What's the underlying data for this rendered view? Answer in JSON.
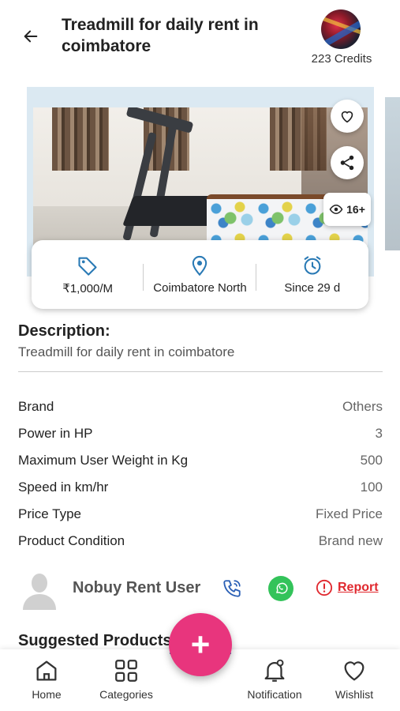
{
  "header": {
    "title": "Treadmill for daily rent in coimbatore",
    "credits": "223 Credits"
  },
  "listing": {
    "views_badge": "16+",
    "price": "₹1,000/M",
    "location": "Coimbatore North",
    "since": "Since 29 d"
  },
  "description": {
    "heading": "Description:",
    "text": "Treadmill for daily rent in coimbatore"
  },
  "specs": [
    {
      "label": "Brand",
      "value": "Others"
    },
    {
      "label": "Power in HP",
      "value": "3"
    },
    {
      "label": "Maximum User Weight in Kg",
      "value": "500"
    },
    {
      "label": "Speed in km/hr",
      "value": "100"
    },
    {
      "label": "Price Type",
      "value": "Fixed Price"
    },
    {
      "label": "Product Condition",
      "value": "Brand new"
    }
  ],
  "owner": {
    "name": "Nobuy Rent User",
    "report_label": "Report"
  },
  "suggested_heading": "Suggested Products",
  "fab_label": "+",
  "bottom_nav": {
    "home": "Home",
    "categories": "Categories",
    "notification": "Notification",
    "wishlist": "Wishlist"
  },
  "colors": {
    "accent_pink": "#e8357d",
    "icon_blue": "#2a7ab5",
    "report_red": "#e0282e",
    "whatsapp_green": "#33c35a"
  }
}
